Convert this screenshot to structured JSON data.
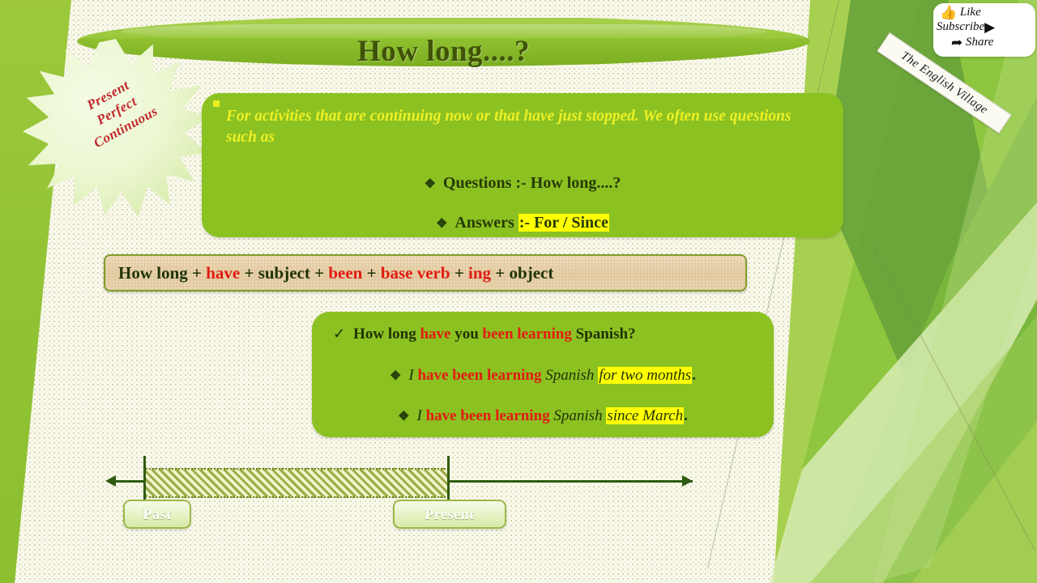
{
  "slide": {
    "title": "How long....?",
    "badge": {
      "line1": "Present",
      "line2": "Perfect",
      "line3": "Continuous"
    },
    "main_box": {
      "lead_text": "For activities that are continuing now or that have just stopped. We often use questions such as",
      "questions": {
        "bullet": "diamond-bullet",
        "label": "Questions",
        "separator": ":-",
        "value": "How long....?"
      },
      "answers": {
        "bullet": "diamond-bullet",
        "label": "Answers",
        "highlight": ":- For / Since"
      }
    },
    "formula": {
      "p1": "How long",
      "op1": "+",
      "p2": "have",
      "op2": "+",
      "p3": "subject",
      "op3": "+",
      "p4": "been",
      "op4": "+",
      "p5": "base verb",
      "op5": "+",
      "p6": "ing",
      "op6": "+",
      "p7": "object"
    },
    "examples": {
      "line1": {
        "bullet": "check-bullet",
        "a": "How long ",
        "b": "have",
        "c": " you ",
        "d": "been learning",
        "e": " Spanish?"
      },
      "line2": {
        "bullet": "diamond-bullet",
        "a": "I ",
        "b": "have been learning",
        "c": " Spanish",
        "d": "for two months",
        "e": "."
      },
      "line3": {
        "bullet": "diamond-bullet",
        "a": "I ",
        "b": "have been learning",
        "c": " Spanish ",
        "d": "since March",
        "e": "."
      }
    },
    "timeline": {
      "past_label": "Past",
      "present_label": "Present"
    },
    "watermark": {
      "like": "Like",
      "subscribe": "Subscribe",
      "share": "Share",
      "ribbon": "The English Village"
    },
    "colors": {
      "green_box": "#8cc122",
      "yellow_text": "#ecf125",
      "dark_green_text": "#1f3305",
      "red_text": "#e21b12",
      "highlight": "#ffff00",
      "badge_red": "#c1272d",
      "title_text": "#3f5307",
      "formula_bg": "#e6cfa7",
      "timeline_line": "#2f5b10"
    }
  }
}
